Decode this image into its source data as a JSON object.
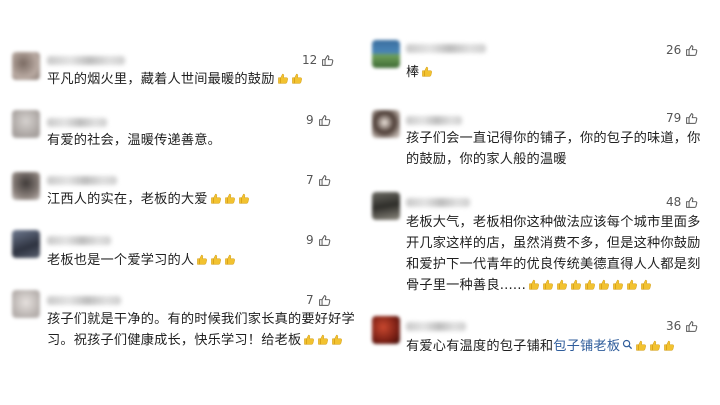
{
  "left_comments": [
    {
      "likes": "12",
      "text": "平凡的烟火里，藏着人世间最暖的鼓励",
      "emoji_count": 2
    },
    {
      "likes": "9",
      "text": "有爱的社会，温暖传递善意。",
      "emoji_count": 0
    },
    {
      "likes": "7",
      "text": "江西人的实在，老板的大爱",
      "emoji_count": 3
    },
    {
      "likes": "9",
      "text": "老板也是一个爱学习的人",
      "emoji_count": 3
    },
    {
      "likes": "7",
      "line1": "孩子们就是干净的。有的时候我们家长真的要好好学",
      "line2": "习。祝孩子们健康成长，快乐学习！给老板",
      "emoji_count": 3
    }
  ],
  "right_comments": [
    {
      "likes": "26",
      "text": "棒",
      "emoji_count": 1
    },
    {
      "likes": "79",
      "line1": "孩子们会一直记得你的铺子，你的包子的味道，你",
      "line2": "的鼓励，你的家人般的温暖",
      "emoji_count": 0
    },
    {
      "likes": "48",
      "line1": "老板大气，老板相你这种做法应该每个城市里面多",
      "line2": "开几家这样的店，虽然消费不多，但是这种你鼓励",
      "line3": "和爱护下一代青年的优良传统美德直得人人都是刻",
      "line4": "骨子里一种善良......",
      "emoji_count": 9
    },
    {
      "likes": "36",
      "text_prefix": "有爱心有温度的包子铺和",
      "link_text": "包子铺老板",
      "emoji_count": 3
    }
  ],
  "icons": {
    "like": "thumbs-up-outline-icon",
    "emoji": "thumbs-up-emoji-icon",
    "search": "search-icon"
  },
  "colors": {
    "link": "#2f5d9b",
    "text": "#1f1f1f",
    "count": "#555555"
  }
}
